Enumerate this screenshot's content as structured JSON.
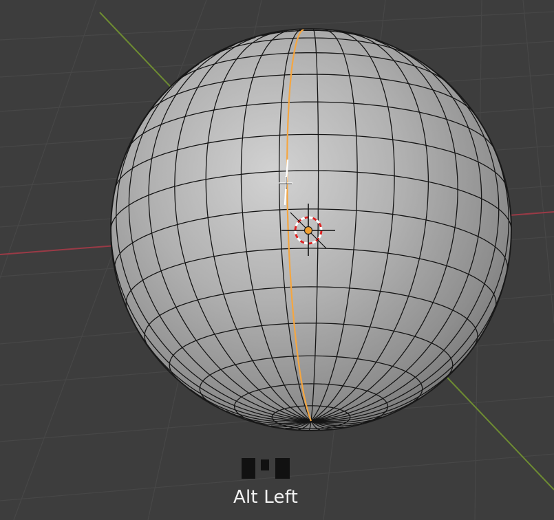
{
  "viewport": {
    "background": "#3d3d3d",
    "grid_color": "#474747",
    "x_axis_color": "#9a3a46",
    "y_axis_color": "#6e8c32"
  },
  "object": {
    "type": "uv-sphere",
    "segments": 32,
    "rings": 16,
    "selected_loop_color": "#f5a640",
    "active_edge_color": "#ffffff",
    "origin_color": "#f0a030"
  },
  "input_overlay": {
    "mouse_icon": "mouse-left-click-icon",
    "key_label": "Alt Left",
    "label_color": "#f2f2f2"
  }
}
